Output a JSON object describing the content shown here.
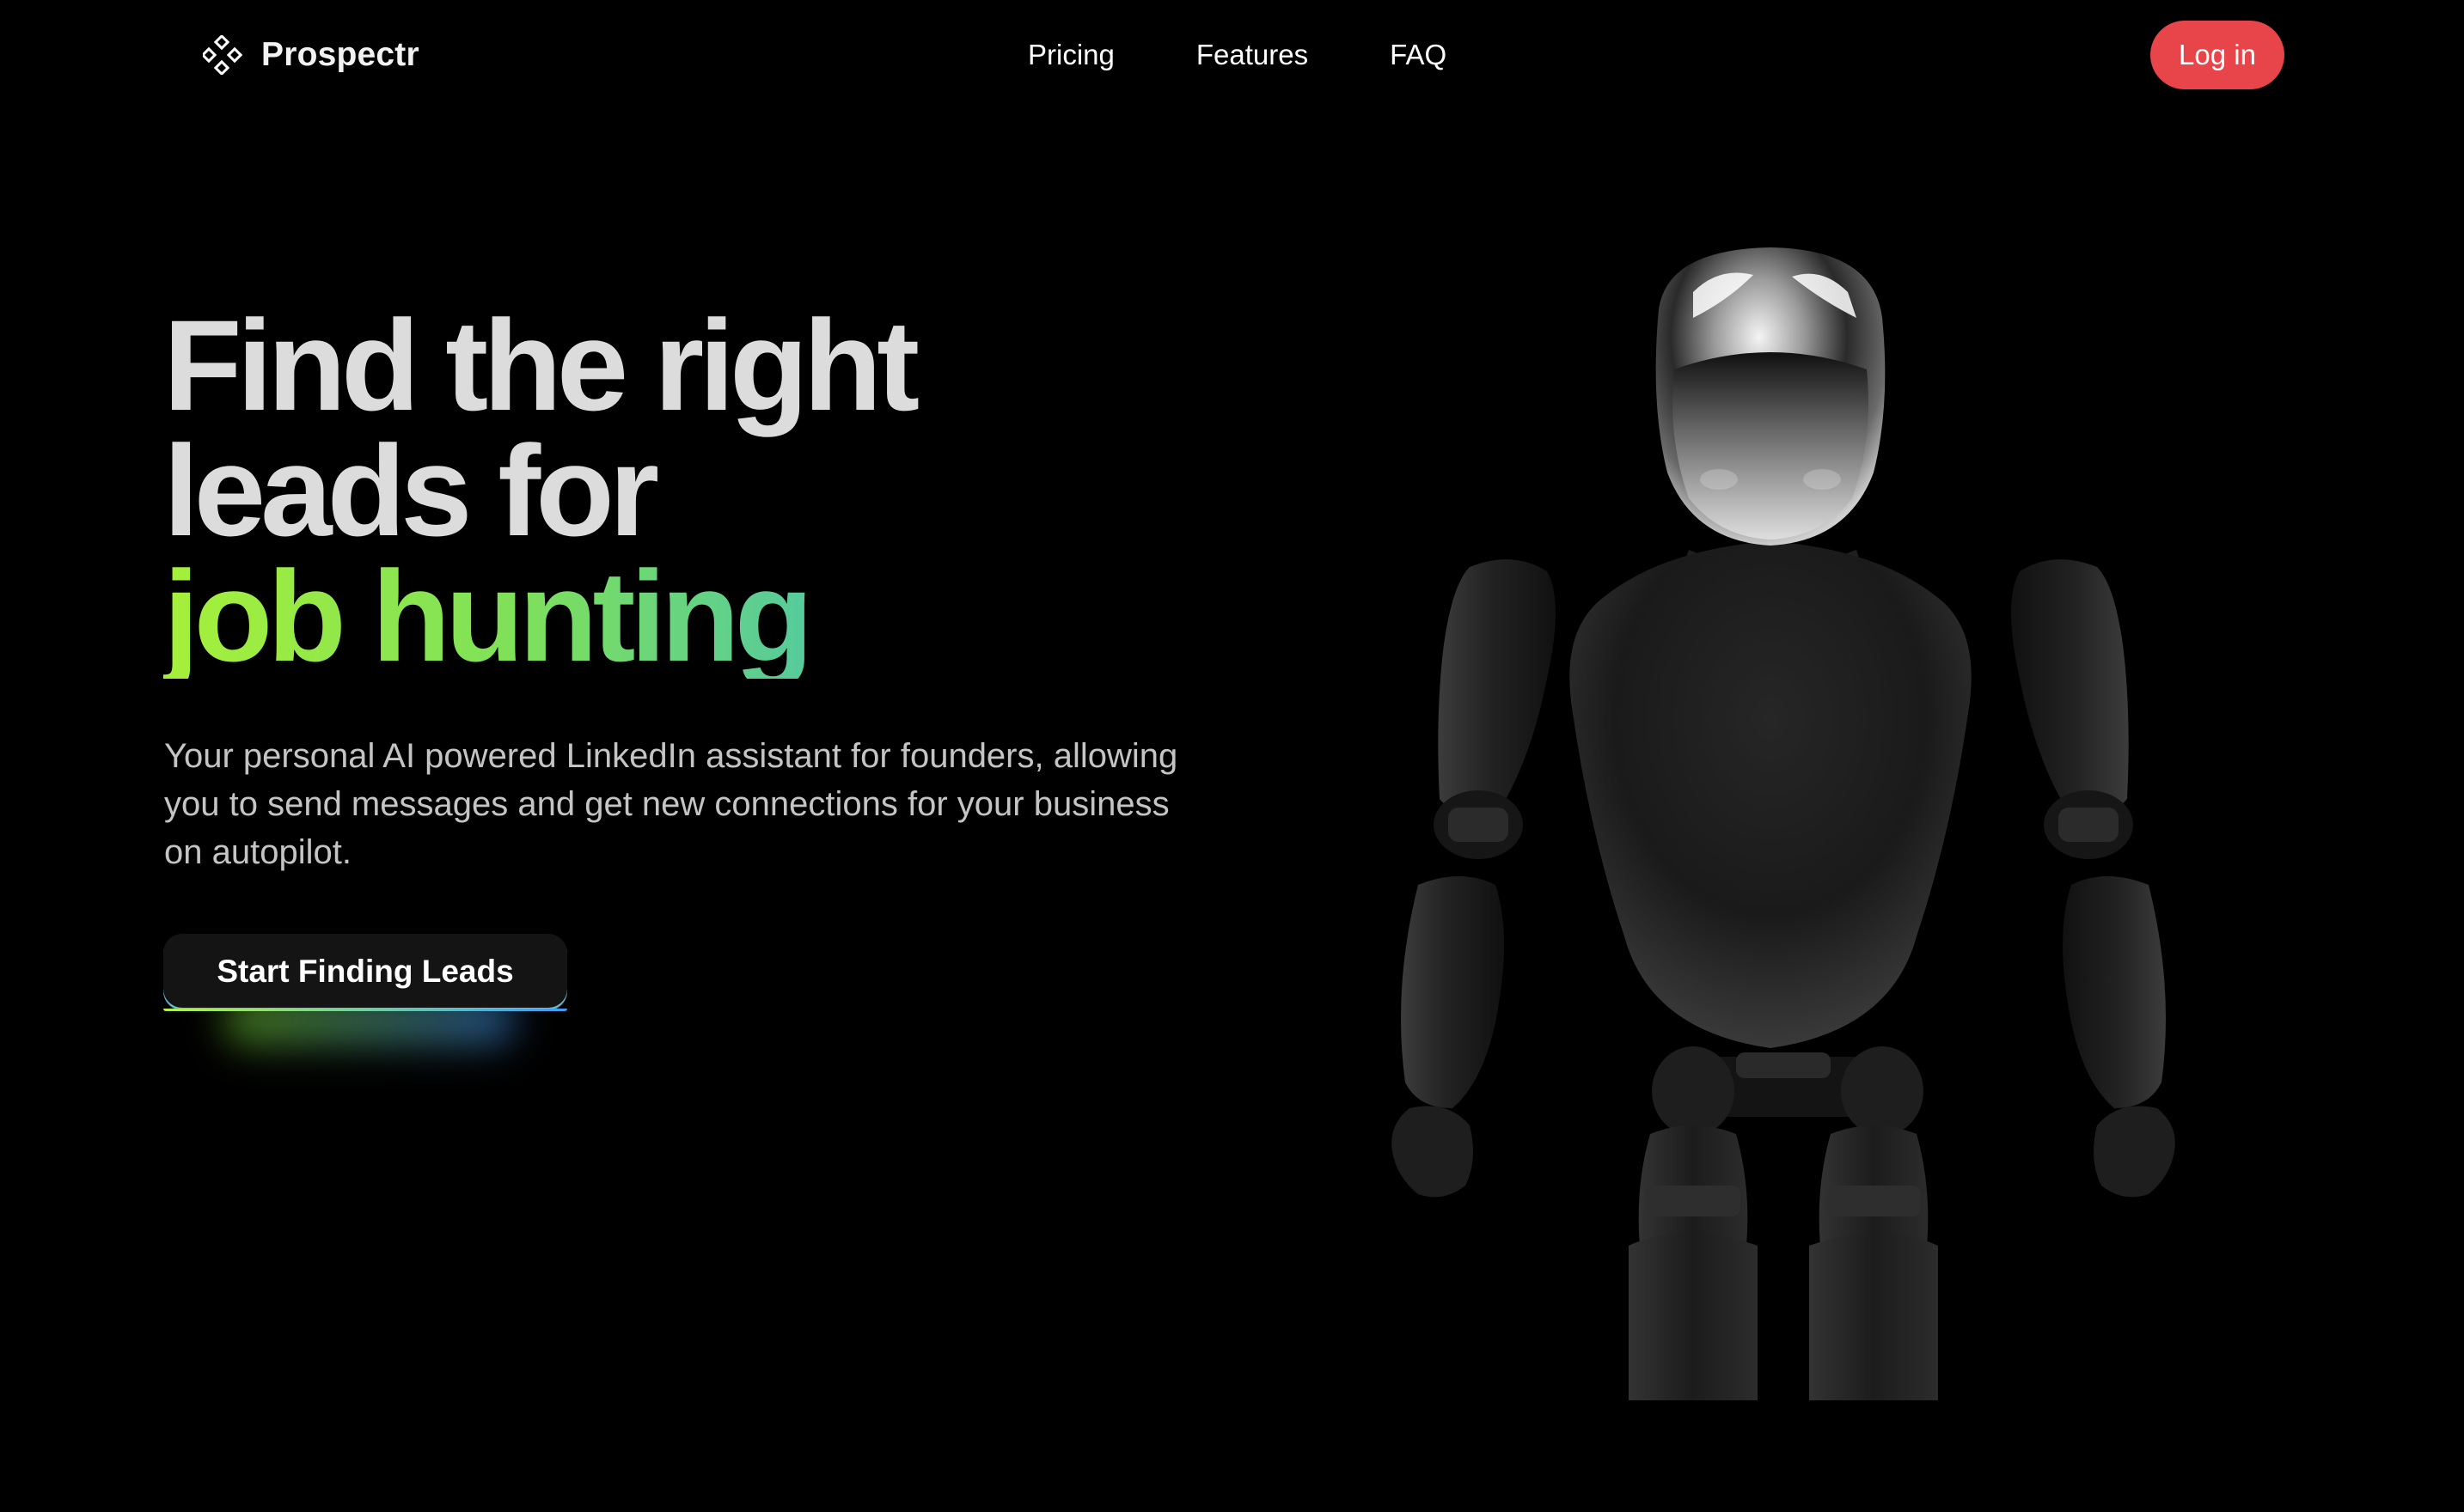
{
  "nav": {
    "brand_name": "Prospectr",
    "brand_icon": "diamond-grid-icon",
    "links": [
      "Pricing",
      "Features",
      "FAQ"
    ],
    "login_label": "Log in"
  },
  "hero": {
    "headline_line1": "Find the right",
    "headline_line2": "leads for",
    "headline_accent": "job hunting",
    "subtitle": "Your personal AI powered LinkedIn assistant for founders, allowing you to send messages and get new connections for your business on autopilot.",
    "cta_label": "Start Finding Leads"
  },
  "colors": {
    "background": "#000000",
    "login_button": "#e8454a",
    "accent_gradient_start": "#a6f03a",
    "accent_gradient_end": "#3f9cf5",
    "headline": "#dcdcdc"
  }
}
